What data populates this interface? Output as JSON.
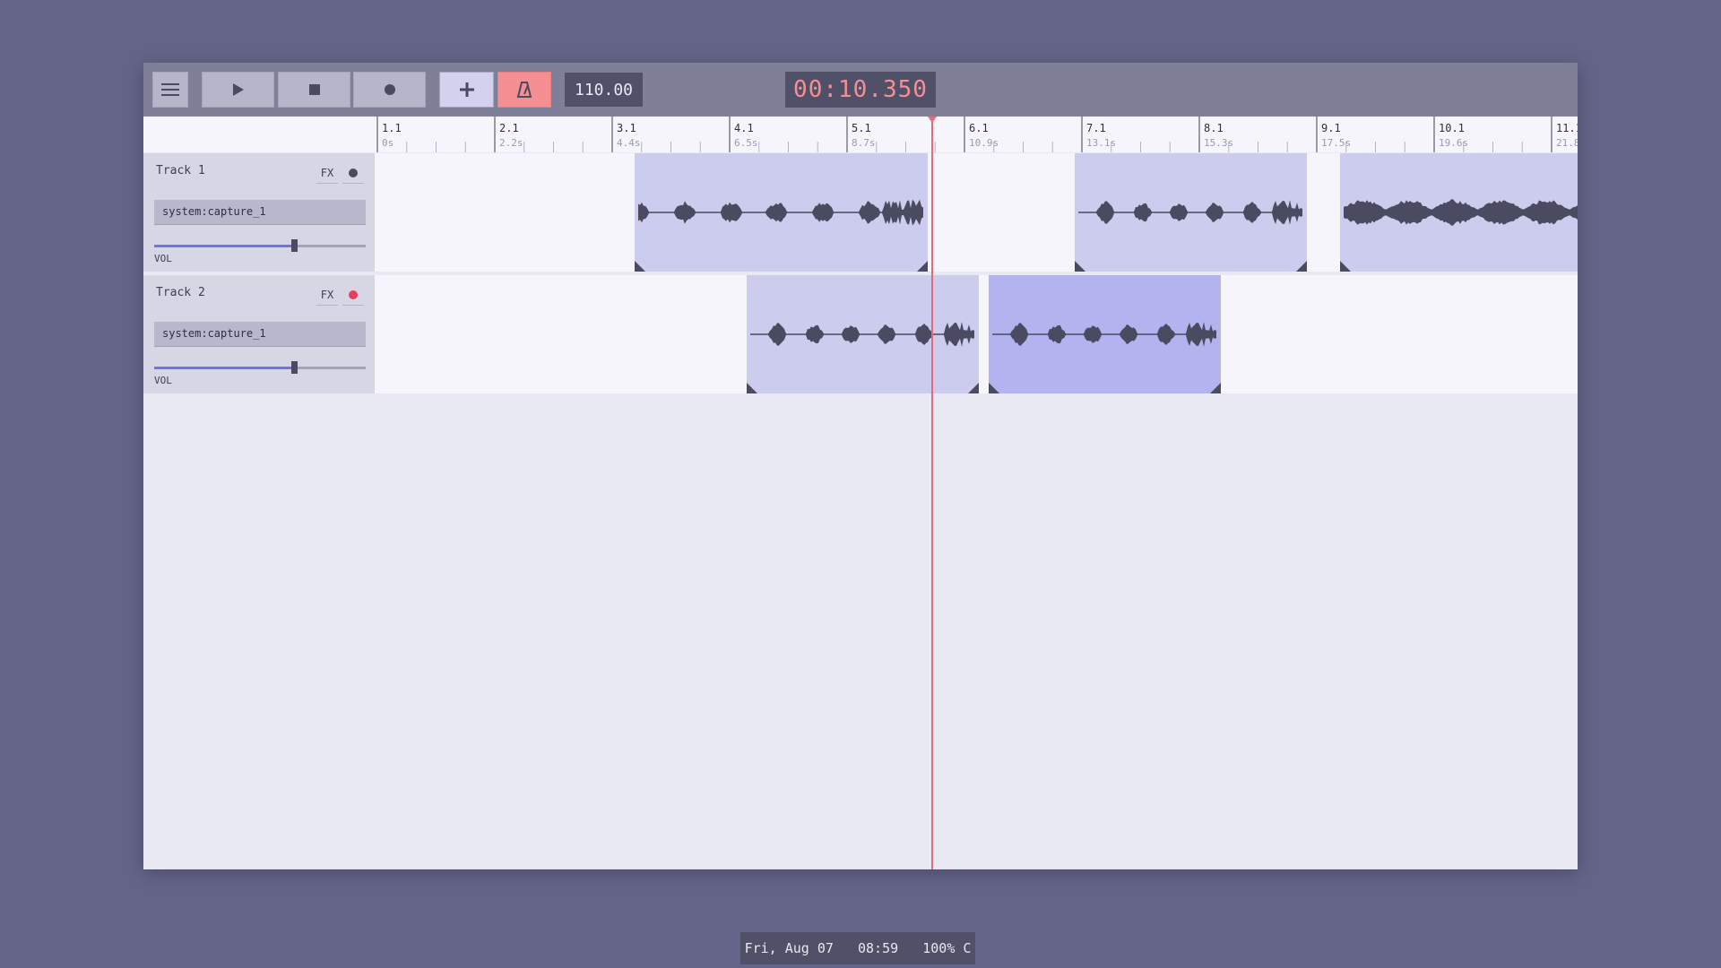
{
  "toolbar": {
    "menu_icon": "hamburger-icon",
    "play_icon": "play-icon",
    "stop_icon": "stop-icon",
    "record_icon": "record-icon",
    "add_icon": "plus-icon",
    "metronome_icon": "metronome-icon",
    "bpm": "110.00",
    "time": "00:10.350"
  },
  "ruler": {
    "bars": [
      {
        "bar": "1.1",
        "time": "0s"
      },
      {
        "bar": "2.1",
        "time": "2.2s"
      },
      {
        "bar": "3.1",
        "time": "4.4s"
      },
      {
        "bar": "4.1",
        "time": "6.5s"
      },
      {
        "bar": "5.1",
        "time": "8.7s"
      },
      {
        "bar": "6.1",
        "time": "10.9s"
      },
      {
        "bar": "7.1",
        "time": "13.1s"
      },
      {
        "bar": "8.1",
        "time": "15.3s"
      },
      {
        "bar": "9.1",
        "time": "17.5s"
      },
      {
        "bar": "10.1",
        "time": "19.6s"
      },
      {
        "bar": "11.1",
        "time": "21.8s"
      }
    ]
  },
  "tracks": [
    {
      "name": "Track 1",
      "fx_label": "FX",
      "input": "system:capture_1",
      "vol_label": "VOL",
      "volume": 0.66,
      "armed": false
    },
    {
      "name": "Track 2",
      "fx_label": "FX",
      "input": "system:capture_1",
      "vol_label": "VOL",
      "volume": 0.66,
      "armed": true
    }
  ],
  "status": {
    "text": "Fri, Aug 07   08:59   100% C"
  },
  "colors": {
    "background": "#646489",
    "clip": "#cccdee",
    "clip_selected": "#b2b3ef",
    "playhead": "#e46a7e",
    "metronome_active": "#f58f93",
    "arm_active": "#e8405a"
  }
}
